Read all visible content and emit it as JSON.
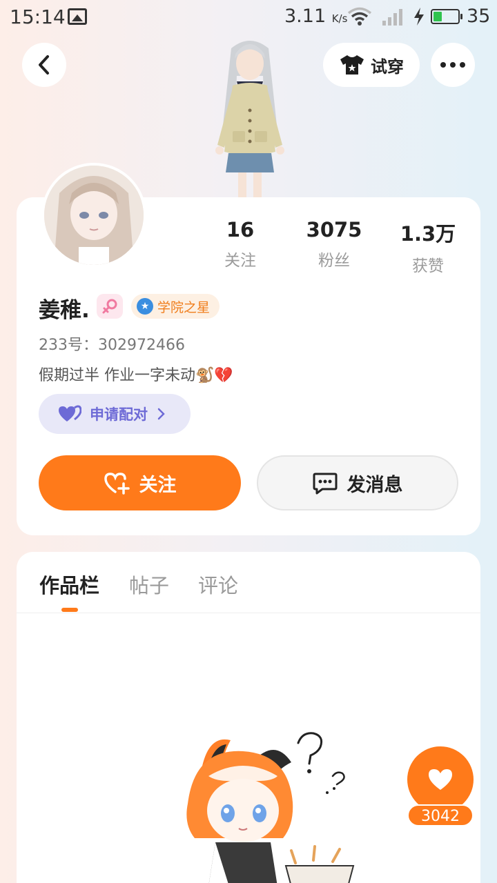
{
  "status_bar": {
    "time": "15:14",
    "network_speed": "3.11",
    "network_unit": "K/s",
    "battery": "35",
    "battery_color": "#2fc34e"
  },
  "header": {
    "back_icon": "chevron-left-icon",
    "try_on_label": "试穿",
    "try_on_icon": "tshirt-icon",
    "more_icon": "more-dots-icon"
  },
  "profile": {
    "name": "姜稚.",
    "gender_icon": "female-icon",
    "badge_label": "学院之星",
    "uid": "233号：302972466",
    "bio": "假期过半  作业一字未动🐒💔",
    "pair_label": "申请配对",
    "stats": [
      {
        "value": "16",
        "label": "关注"
      },
      {
        "value": "3075",
        "label": "粉丝"
      },
      {
        "value": "1.3万",
        "label": "获赞"
      }
    ],
    "follow_label": "关注",
    "message_label": "发消息"
  },
  "tabs": [
    {
      "label": "作品栏",
      "active": true
    },
    {
      "label": "帖子",
      "active": false
    },
    {
      "label": "评论",
      "active": false
    }
  ],
  "floating_like": {
    "count": "3042",
    "icon": "heart-icon"
  },
  "colors": {
    "accent": "#ff7a1a",
    "pair_bg": "#e8e8f8",
    "pair_text": "#6d6ad6"
  }
}
